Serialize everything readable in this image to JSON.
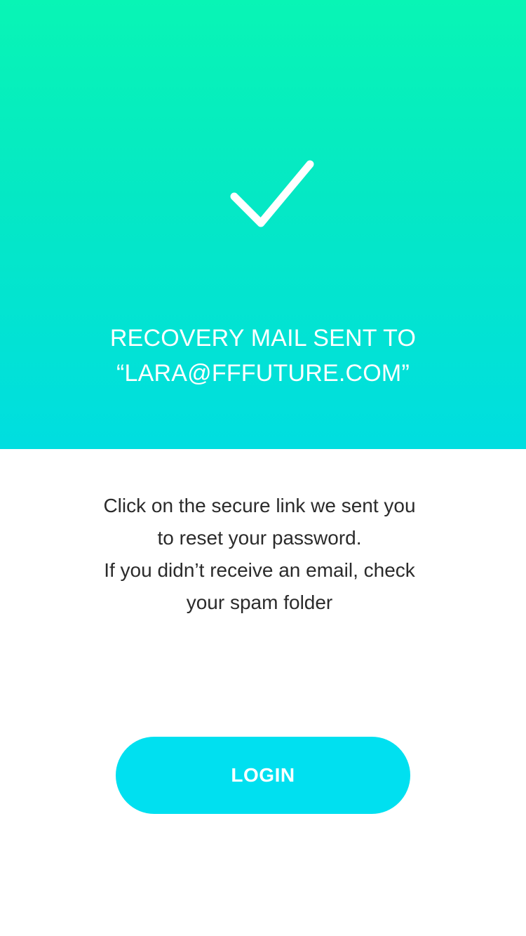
{
  "hero": {
    "icon": "checkmark-icon",
    "title_line1": "RECOVERY MAIL SENT TO",
    "title_line2": "“LARA@FFFUTURE.COM”",
    "gradient_top": "#08f5b5",
    "gradient_bottom": "#00dee0"
  },
  "message": {
    "line1": "Click on the secure link we sent you",
    "line2": "to reset your password.",
    "line3": "If you didn’t receive an email, check",
    "line4": "your spam folder"
  },
  "login_button": {
    "label": "LOGIN",
    "color": "#00e0f0"
  }
}
